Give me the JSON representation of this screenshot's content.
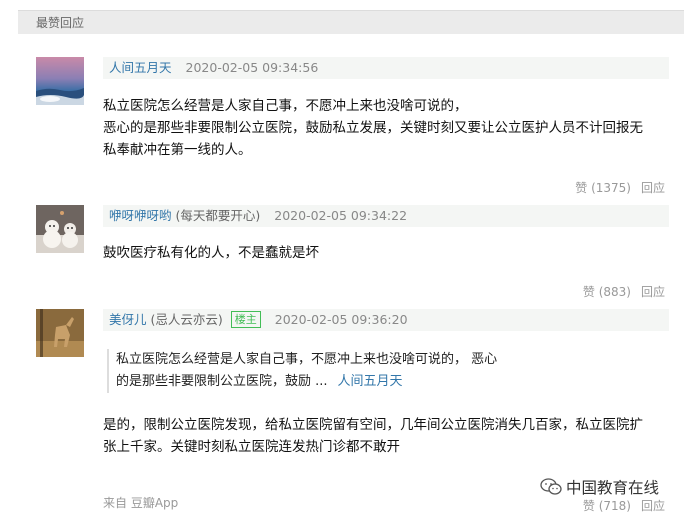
{
  "section": {
    "title": "最赞回应"
  },
  "comments": [
    {
      "author": "人间五月天",
      "signature": "",
      "time": "2020-02-05 09:34:56",
      "body_lines": [
        "私立医院怎么经营是人家自己事，不愿冲上来也没啥可说的，",
        "恶心的是那些非要限制公立医院，鼓励私立发展，关键时刻又要让公立医护人员不计回报无",
        "私奉献冲在第一线的人。"
      ],
      "likes": "赞 (1375)",
      "reply": "回应"
    },
    {
      "author": "咿呀咿呀哟",
      "signature": "(每天都要开心)",
      "time": "2020-02-05 09:34:22",
      "body_lines": [
        "鼓吹医疗私有化的人，不是蠢就是坏"
      ],
      "likes": "赞 (883)",
      "reply": "回应"
    },
    {
      "author": "美伢儿",
      "signature": "(忌人云亦云)",
      "badge": "楼主",
      "time": "2020-02-05 09:36:20",
      "quote_lines": [
        "私立医院怎么经营是人家自己事，不愿冲上来也没啥可说的， 恶心",
        "的是那些非要限制公立医院，鼓励 ..."
      ],
      "quote_author": "人间五月天",
      "body_lines": [
        "是的，限制公立医院发现，给私立医院留有空间，几年间公立医院消失几百家，私立医院扩",
        "张上千家。关键时刻私立医院连发热门诊都不敢开"
      ],
      "likes": "赞 (718)",
      "reply": "回应"
    }
  ],
  "footer": {
    "source": "来自 豆瓣App"
  },
  "watermark": {
    "text": "中国教育在线"
  },
  "colors": {
    "link": "#3377aa",
    "badge": "#42bd56",
    "meta_bg": "#f4f6f4"
  }
}
